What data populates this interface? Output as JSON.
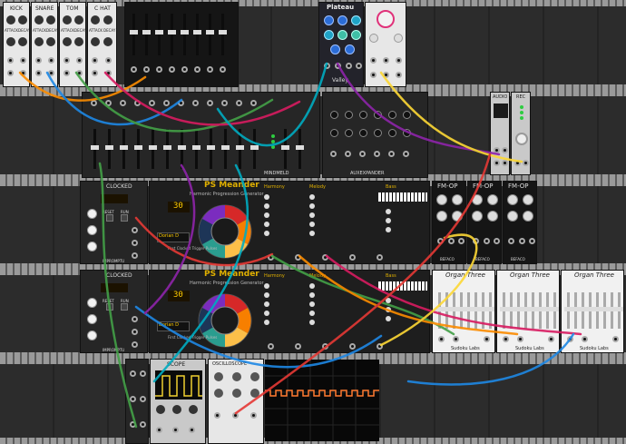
{
  "rack": {
    "drum_modules": [
      {
        "name": "KICK",
        "label_1": "ATTACK",
        "label_2": "DECAY"
      },
      {
        "name": "SNARE",
        "label_1": "ATTACK",
        "label_2": "DECAY"
      },
      {
        "name": "TOM",
        "label_1": "ATTACK",
        "label_2": "DECAY"
      },
      {
        "name": "C HAT",
        "label_1": "ATTACK",
        "label_2": "DECAY"
      }
    ],
    "plateau": {
      "title": "Plateau",
      "subtitle": "Valley"
    },
    "audio": {
      "title": "AUDIO"
    },
    "rec": {
      "title": "REC"
    },
    "clocked": [
      {
        "title": "CLOCKED",
        "bpm": "",
        "reset_label": "RESET",
        "run_label": "RUN",
        "brand": "IMPROMPTU"
      },
      {
        "title": "CLOCKED",
        "bpm": "",
        "reset_label": "RESET",
        "run_label": "RUN",
        "brand": "IMPROMPTU"
      }
    ],
    "meander": [
      {
        "title": "PS Meander",
        "subtitle": "Harmonic Progression Generator",
        "readout": "30",
        "key_display": "Dorian D",
        "harmony_title": "Harmony",
        "melody_title": "Melody",
        "bass_title": "Bass",
        "footer": "First Clocked Trigger Pulses"
      },
      {
        "title": "PS Meander",
        "subtitle": "Harmonic Progression Generator",
        "readout": "30",
        "key_display": "Dorian D",
        "harmony_title": "Harmony",
        "melody_title": "Melody",
        "bass_title": "Bass",
        "footer": "First Clocked Trigger Pulses"
      }
    ],
    "fm_op": [
      {
        "title": "FM-OP",
        "brand": "BEFACO"
      },
      {
        "title": "FM-OP",
        "brand": "BEFACO"
      },
      {
        "title": "FM-OP",
        "brand": "BEFACO"
      }
    ],
    "organ": [
      {
        "title": "Organ Three",
        "footer": "Sudoku Labs"
      },
      {
        "title": "Organ Three",
        "footer": "Sudoku Labs"
      },
      {
        "title": "Organ Three",
        "footer": "Sudoku Labs"
      }
    ],
    "scope": {
      "title": "SCOPE"
    },
    "oscilloscope": {
      "title": "OSCILLOSCOPE"
    },
    "mixer": {
      "brand": "MINDMELD"
    },
    "aux": {
      "title": "AUXEXPANDER"
    }
  },
  "colors": {
    "cable_red": "#e53935",
    "cable_orange": "#fb8c00",
    "cable_yellow": "#fdd835",
    "cable_green": "#43a047",
    "cable_blue": "#1e88e5",
    "cable_purple": "#8e24aa",
    "cable_pink": "#d81b60",
    "cable_cyan": "#00acc1",
    "meander_panel": "#1e1e1e",
    "meander_accent": "#e0b000",
    "scope_trace": "#f0d030",
    "oscilloscope_trace": "#ff7a30"
  }
}
